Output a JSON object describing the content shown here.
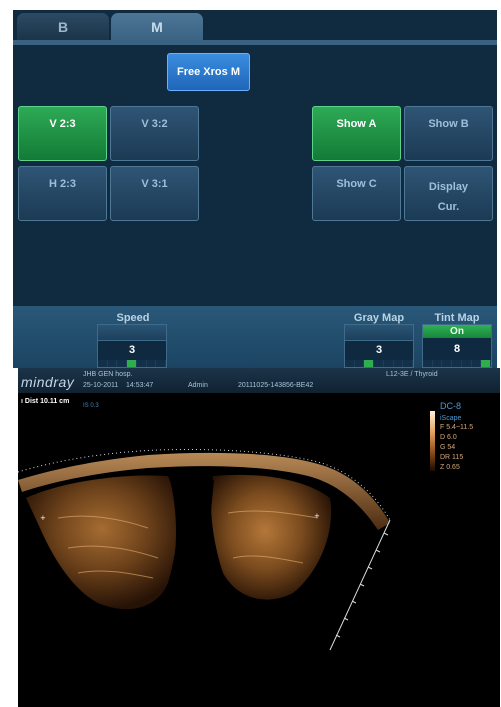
{
  "tabs": [
    {
      "label": "B"
    },
    {
      "label": "M"
    }
  ],
  "free_xros": {
    "label": "Free Xros M"
  },
  "layout_buttons": [
    {
      "label": "V 2:3",
      "active": true
    },
    {
      "label": "V 3:2",
      "active": false
    },
    {
      "label": "H 2:3",
      "active": false
    },
    {
      "label": "V 3:1",
      "active": false
    }
  ],
  "show_buttons": [
    {
      "label": "Show A",
      "active": true
    },
    {
      "label": "Show B",
      "active": false
    },
    {
      "label": "Show C",
      "active": false
    },
    {
      "label_line1": "Display",
      "label_line2": "Cur.",
      "active": false
    }
  ],
  "controls": {
    "speed": {
      "label": "Speed",
      "value": "3"
    },
    "gray_map": {
      "label": "Gray Map",
      "value": "3"
    },
    "tint_map": {
      "label": "Tint Map",
      "state": "On",
      "value": "8"
    }
  },
  "header": {
    "logo": "mindray",
    "hospital": "JHB GEN hosp.",
    "date": "25-10-2011",
    "time": "14:53:47",
    "user": "Admin",
    "exam_id": "20111025-143856-BE42",
    "probe": "L12-3E / Thyroid"
  },
  "measurement": {
    "label": "Dist",
    "value": "10.11 cm"
  },
  "is_label": "IS 0.3",
  "params": {
    "mode": "DC-8",
    "iscape": "iScape",
    "f": "F 5.4~11.5",
    "d": "D 6.0",
    "g": "G 54",
    "dr": "DR 115",
    "z": "Z 0.65"
  },
  "colors": {
    "panel_bg": "#102b3f",
    "active_green": "#2eaa55",
    "accent_blue": "#3a8de0",
    "tint": "#c07a3a"
  }
}
